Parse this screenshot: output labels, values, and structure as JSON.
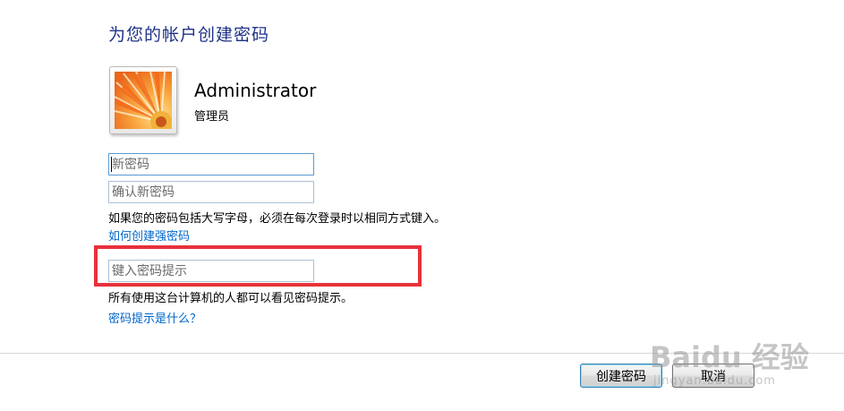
{
  "window": {
    "title": "为您的帐户创建密码"
  },
  "account": {
    "name": "Administrator",
    "role": "管理员",
    "avatar_icon": "flower-avatar-icon"
  },
  "form": {
    "new_password_placeholder": "新密码",
    "confirm_password_placeholder": "确认新密码",
    "caps_notice": "如果您的密码包括大写字母，必须在每次登录时以相同方式键入。",
    "strong_password_link": "如何创建强密码",
    "hint_placeholder": "键入密码提示",
    "hint_visibility_notice": "所有使用这台计算机的人都可以看见密码提示。",
    "hint_help_link": "密码提示是什么？"
  },
  "buttons": {
    "create_label": "创建密码",
    "cancel_label": "取消"
  },
  "watermark": {
    "logo_text": "Baidu 经验",
    "url_text": "jingyan.baidu.com"
  },
  "colors": {
    "title": "#1e3287",
    "link": "#0066cc",
    "highlight": "#e8313a"
  }
}
